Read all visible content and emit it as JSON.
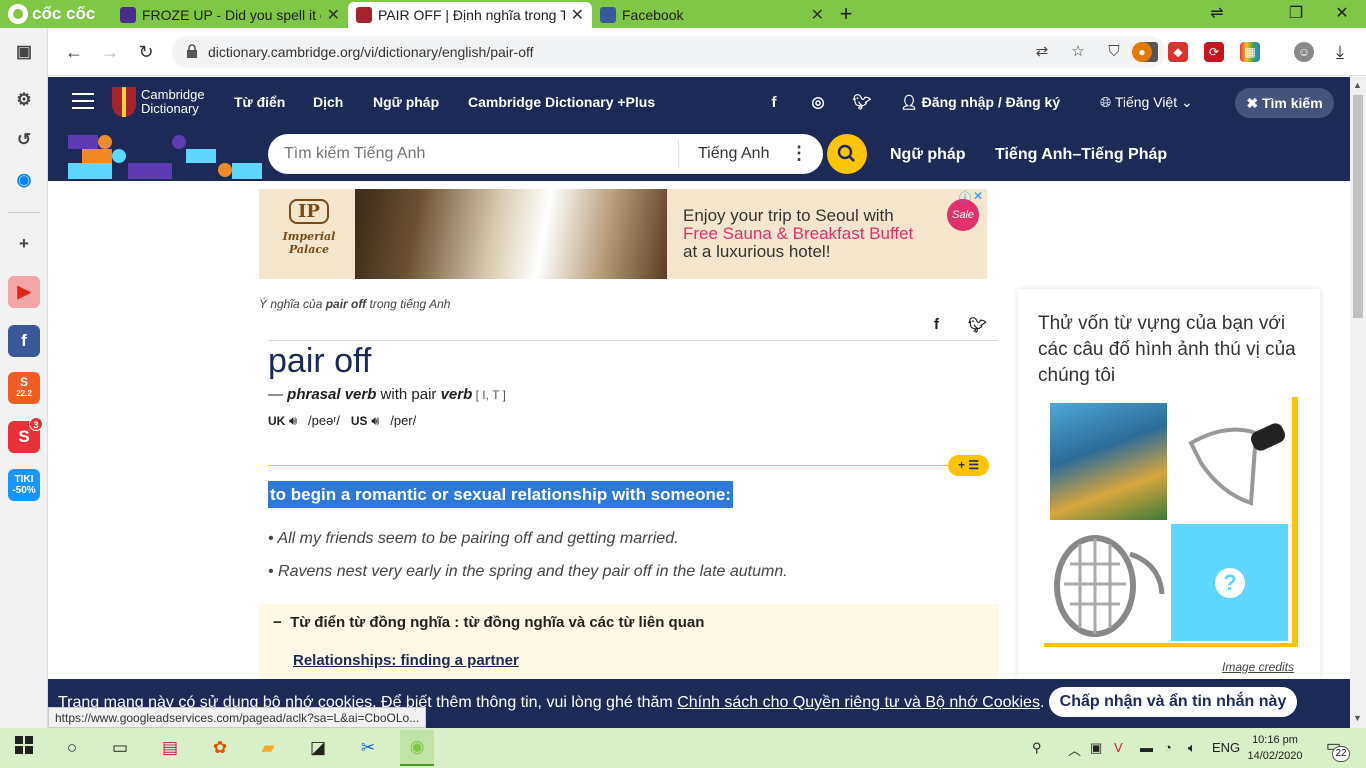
{
  "browser": {
    "brand": "cốc cốc",
    "tabs": [
      {
        "title": "FROZE UP - Did you spell it co",
        "active": false
      },
      {
        "title": "PAIR OFF | Định nghĩa trong T",
        "active": true
      },
      {
        "title": "Facebook",
        "active": false
      }
    ],
    "url": "dictionary.cambridge.org/vi/dictionary/english/pair-off"
  },
  "sidebar": {
    "shop_badge": "22.2",
    "notif_count": "3",
    "tiki_label": "TIKI",
    "tiki_discount": "-50%"
  },
  "header": {
    "logo_line1": "Cambridge",
    "logo_line2": "Dictionary",
    "nav": [
      "Từ điển",
      "Dịch",
      "Ngữ pháp",
      "Cambridge Dictionary +Plus"
    ],
    "login": "Đăng nhập / Đăng ký",
    "language": "Tiếng Việt",
    "search_toggle": "Tìm kiếm"
  },
  "search": {
    "placeholder": "Tìm kiếm Tiếng Anh",
    "dictionary": "Tiếng Anh",
    "links": [
      "Ngữ pháp",
      "Tiếng Anh–Tiếng Pháp"
    ]
  },
  "ad": {
    "brand_mark": "IP",
    "brand_name": "Imperial Palace",
    "line1": "Enjoy your trip to Seoul with",
    "line2": "Free Sauna & Breakfast Buffet",
    "line3": "at a luxurious hotel!",
    "badge": "Sale"
  },
  "entry": {
    "crumb_pre": "Ý nghĩa của ",
    "crumb_word": "pair off",
    "crumb_post": " trong tiếng Anh",
    "headword": "pair off",
    "pos_dash": "— ",
    "pos": "phrasal verb",
    "pos_with": " with pair ",
    "pos_verb": "verb",
    "grammar": " [ I, T ]",
    "uk_label": "UK",
    "uk_ipa": "/peəʳ/",
    "us_label": "US",
    "us_ipa": "/per/",
    "definition": "to begin a romantic or sexual relationship with someone:",
    "examples": [
      "All my friends seem to be pairing off and getting married.",
      "Ravens nest very early in the spring and they pair off in the late autumn."
    ],
    "thesaurus_title": "Từ điển từ đồng nghĩa : từ đồng nghĩa và các từ liên quan",
    "thesaurus_link": "Relationships: finding a partner"
  },
  "quiz": {
    "title": "Thử vốn từ vựng của bạn với các câu đố hình ảnh thú vị của chúng tôi",
    "credits": "Image credits"
  },
  "cookie": {
    "text_pre": "Trang mạng này có sử dụng bộ nhớ cookies. Để biết thêm thông tin, vui lòng ghé thăm ",
    "link": "Chính sách cho Quyền riêng tư và Bộ nhớ Cookies",
    "text_post": ".",
    "button": "Chấp nhận và ẩn tin nhắn này"
  },
  "status_url": "https://www.googleadservices.com/pagead/aclk?sa=L&ai=CboOLo...",
  "taskbar": {
    "lang": "ENG",
    "time": "10:16 pm",
    "date": "14/02/2020",
    "notif": "22"
  },
  "colors": {
    "cambridge_navy": "#1d2a57",
    "cambridge_yellow": "#fec400",
    "coccoc_green": "#7ec846",
    "selection_blue": "#2e79d8"
  }
}
